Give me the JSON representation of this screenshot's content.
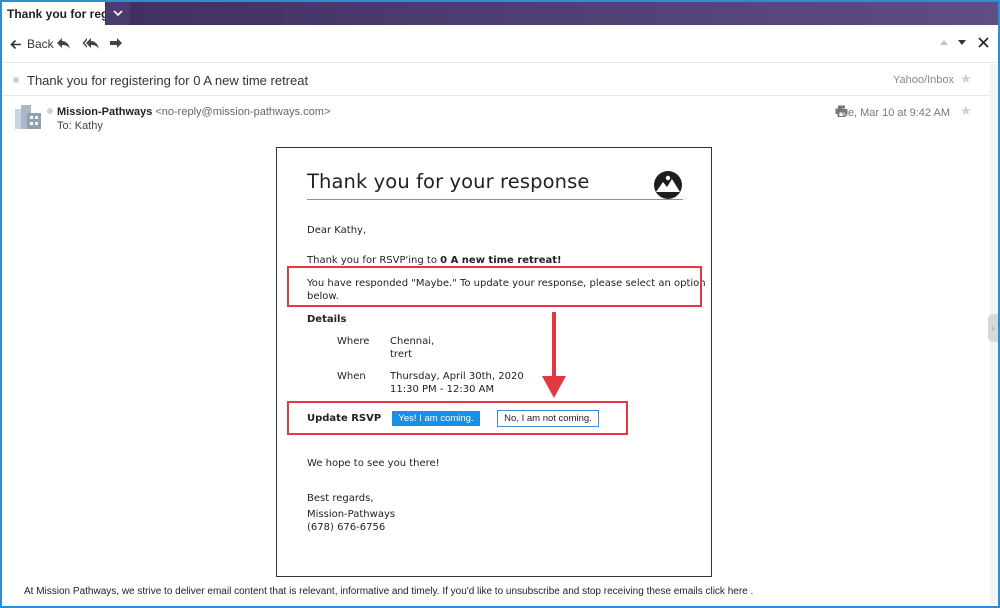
{
  "tab": {
    "title": "Thank you for registe"
  },
  "toolbar": {
    "back_label": "Back"
  },
  "message": {
    "subject": "Thank you for registering for 0 A new time retreat",
    "folder": "Yahoo/Inbox",
    "sender_name": "Mission-Pathways",
    "sender_email": "<no-reply@mission-pathways.com>",
    "to_line": "To: Kathy",
    "date": "Tue, Mar 10 at 9:42 AM"
  },
  "email": {
    "title": "Thank you for your response",
    "greeting": "Dear Kathy,",
    "rsvp_prefix": "Thank you for RSVP'ing to ",
    "event_name": "0 A new time retreat!",
    "response_line1": "You have responded \"Maybe.\" To update your response, please select an option",
    "response_line2": "below.",
    "details_heading": "Details",
    "where_label": "Where",
    "where_line1": "Chennai,",
    "where_line2": "trert",
    "when_label": "When",
    "when_line1": "Thursday, April 30th, 2020",
    "when_line2": "11:30 PM - 12:30 AM",
    "update_rsvp_label": "Update RSVP",
    "yes_button": "Yes! I am coming.",
    "no_button": "No, I am not coming.",
    "closing": "We hope to see you there!",
    "regards": "Best regards,",
    "signature_name": "Mission-Pathways",
    "signature_phone": "(678) 676-6756"
  },
  "footer": {
    "text": "At Mission Pathways, we strive to deliver email content that is relevant, informative and timely. If you'd like to unsubscribe and stop receiving these emails click here ."
  },
  "colors": {
    "tab_bar": "#3a2c5a",
    "frame_border": "#2b8fd6",
    "annotation_red": "#e0393e",
    "yes_button_bg": "#1a8fe8",
    "title_rule": "#3ab0c8"
  },
  "icons": [
    "chevron-down-icon",
    "back-arrow-icon",
    "reply-icon",
    "reply-all-icon",
    "forward-icon",
    "triangle-up-icon",
    "triangle-down-icon",
    "close-icon",
    "star-icon",
    "avatar-icon",
    "print-icon",
    "logo-icon",
    "arrow-down-icon"
  ]
}
